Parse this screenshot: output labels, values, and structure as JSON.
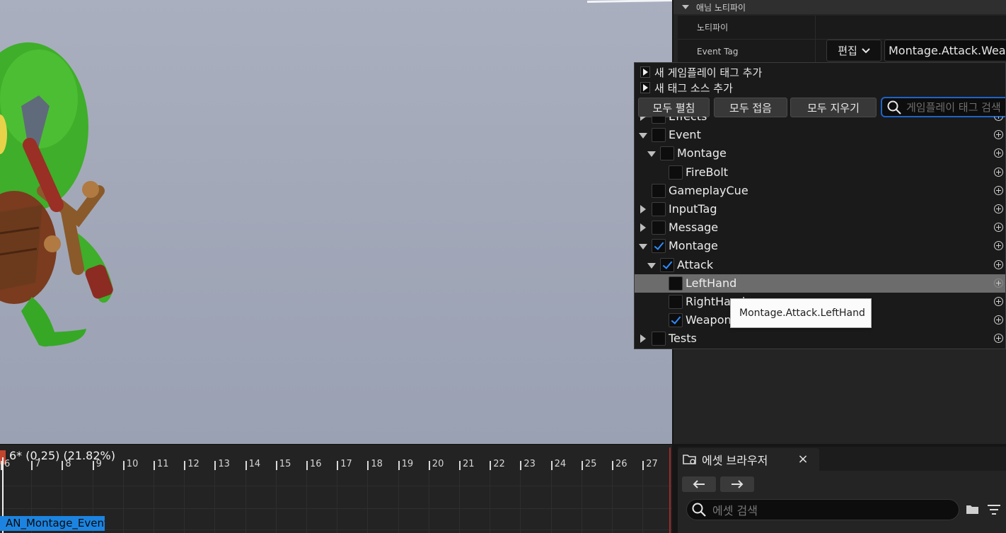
{
  "details": {
    "category_title": "애님 노티파이",
    "rows": [
      {
        "name": "노티파이"
      },
      {
        "name": "Event Tag"
      }
    ],
    "edit_button_label": "편집",
    "event_tag_value": "Montage.Attack.Wea"
  },
  "tag_picker": {
    "add_new_tag_label": "새 게임플레이 태그 추가",
    "add_tag_source_label": "새 태그 소스 추가",
    "expand_all_label": "모두 펼침",
    "collapse_all_label": "모두 접음",
    "clear_all_label": "모두 지우기",
    "search_placeholder": "게임플레이 태그 검색",
    "tree": [
      {
        "label": "Effects",
        "expander": "closed",
        "checked": false,
        "level": 0
      },
      {
        "label": "Event",
        "expander": "open",
        "checked": false,
        "level": 0
      },
      {
        "label": "Montage",
        "expander": "open",
        "checked": false,
        "level": 1
      },
      {
        "label": "FireBolt",
        "expander": "none",
        "checked": false,
        "level": 2
      },
      {
        "label": "GameplayCue",
        "expander": "none",
        "checked": false,
        "level": 0
      },
      {
        "label": "InputTag",
        "expander": "closed",
        "checked": false,
        "level": 0
      },
      {
        "label": "Message",
        "expander": "closed",
        "checked": false,
        "level": 0
      },
      {
        "label": "Montage",
        "expander": "open",
        "checked": true,
        "level": 0
      },
      {
        "label": "Attack",
        "expander": "open",
        "checked": true,
        "level": 1
      },
      {
        "label": "LeftHand",
        "expander": "none",
        "checked": false,
        "level": 2,
        "hover": true
      },
      {
        "label": "RightHand",
        "expander": "none",
        "checked": false,
        "level": 2
      },
      {
        "label": "Weapon",
        "expander": "none",
        "checked": true,
        "level": 2
      },
      {
        "label": "Tests",
        "expander": "closed",
        "checked": false,
        "level": 0
      }
    ],
    "tooltip": "Montage.Attack.LeftHand"
  },
  "timeline": {
    "readout": "6* (0.25) (21.82%)",
    "ruler_labels": [
      "6",
      "7",
      "8",
      "9",
      "10",
      "11",
      "12",
      "13",
      "14",
      "15",
      "16",
      "17",
      "18",
      "19",
      "20",
      "21",
      "22",
      "23",
      "24",
      "25",
      "26",
      "27"
    ],
    "notify_label": "AN_Montage_Event"
  },
  "content_browser": {
    "tab_title": "에셋 브라우저",
    "close_glyph": "×",
    "search_placeholder": "에셋 검색"
  },
  "colors": {
    "accent_blue": "#1e64c8",
    "check_blue": "#2f8cff",
    "notify_blue": "#1c84e0",
    "viewport_bg": "#a2a8b8"
  },
  "icons": [
    "play-icon",
    "search-icon",
    "folder-icon",
    "close-icon",
    "arrow-left-icon",
    "arrow-right-icon",
    "filter-icon",
    "chevron-down-icon",
    "add-circle-icon"
  ]
}
